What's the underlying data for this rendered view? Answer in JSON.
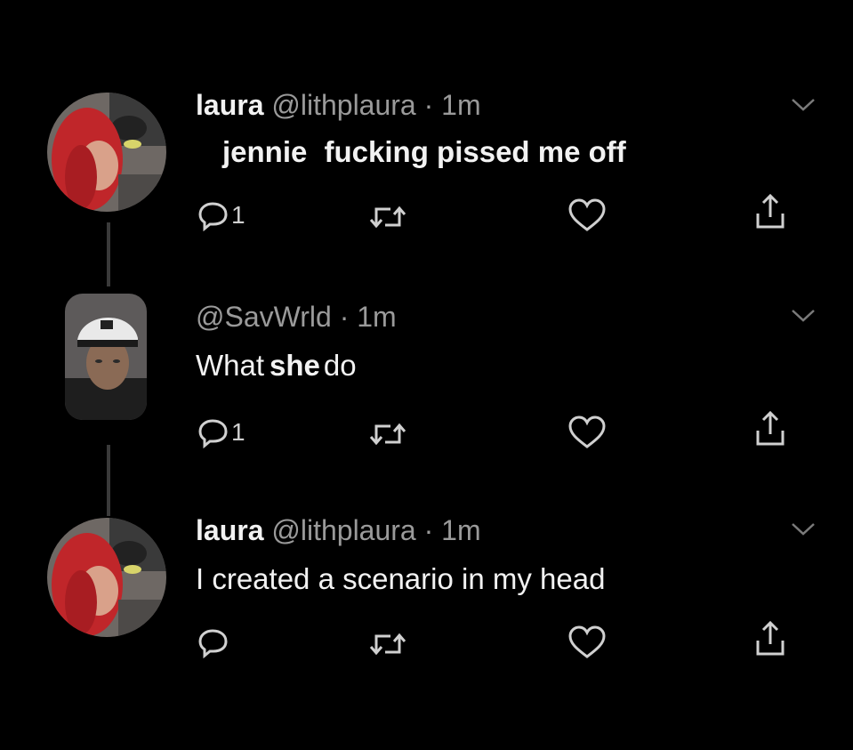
{
  "colors": {
    "background": "#000000",
    "text_primary": "#f2f2f2",
    "text_secondary": "#9a9a9a",
    "icon": "#d0d0d0",
    "thread_line": "#3a3a3a"
  },
  "tweets": [
    {
      "name": "laura",
      "handle": "@lithplaura",
      "separator": "·",
      "time": "1m",
      "text_parts": [
        "jennie",
        "fucking pissed me off"
      ],
      "reply_count": "1",
      "avatar_icon": "avatar-photo-red-hair"
    },
    {
      "name": "",
      "handle": "@SavWrld",
      "separator": "·",
      "time": "1m",
      "text_parts": [
        "What",
        "she",
        "do"
      ],
      "reply_count": "1",
      "avatar_icon": "avatar-photo-cap"
    },
    {
      "name": "laura",
      "handle": "@lithplaura",
      "separator": "·",
      "time": "1m",
      "text_parts": [
        "I created a scenario in my head"
      ],
      "reply_count": "",
      "avatar_icon": "avatar-photo-red-hair"
    }
  ],
  "icons": {
    "reply": "reply-icon",
    "retweet": "retweet-icon",
    "like": "heart-icon",
    "share": "share-icon",
    "caret": "chevron-down-icon"
  }
}
